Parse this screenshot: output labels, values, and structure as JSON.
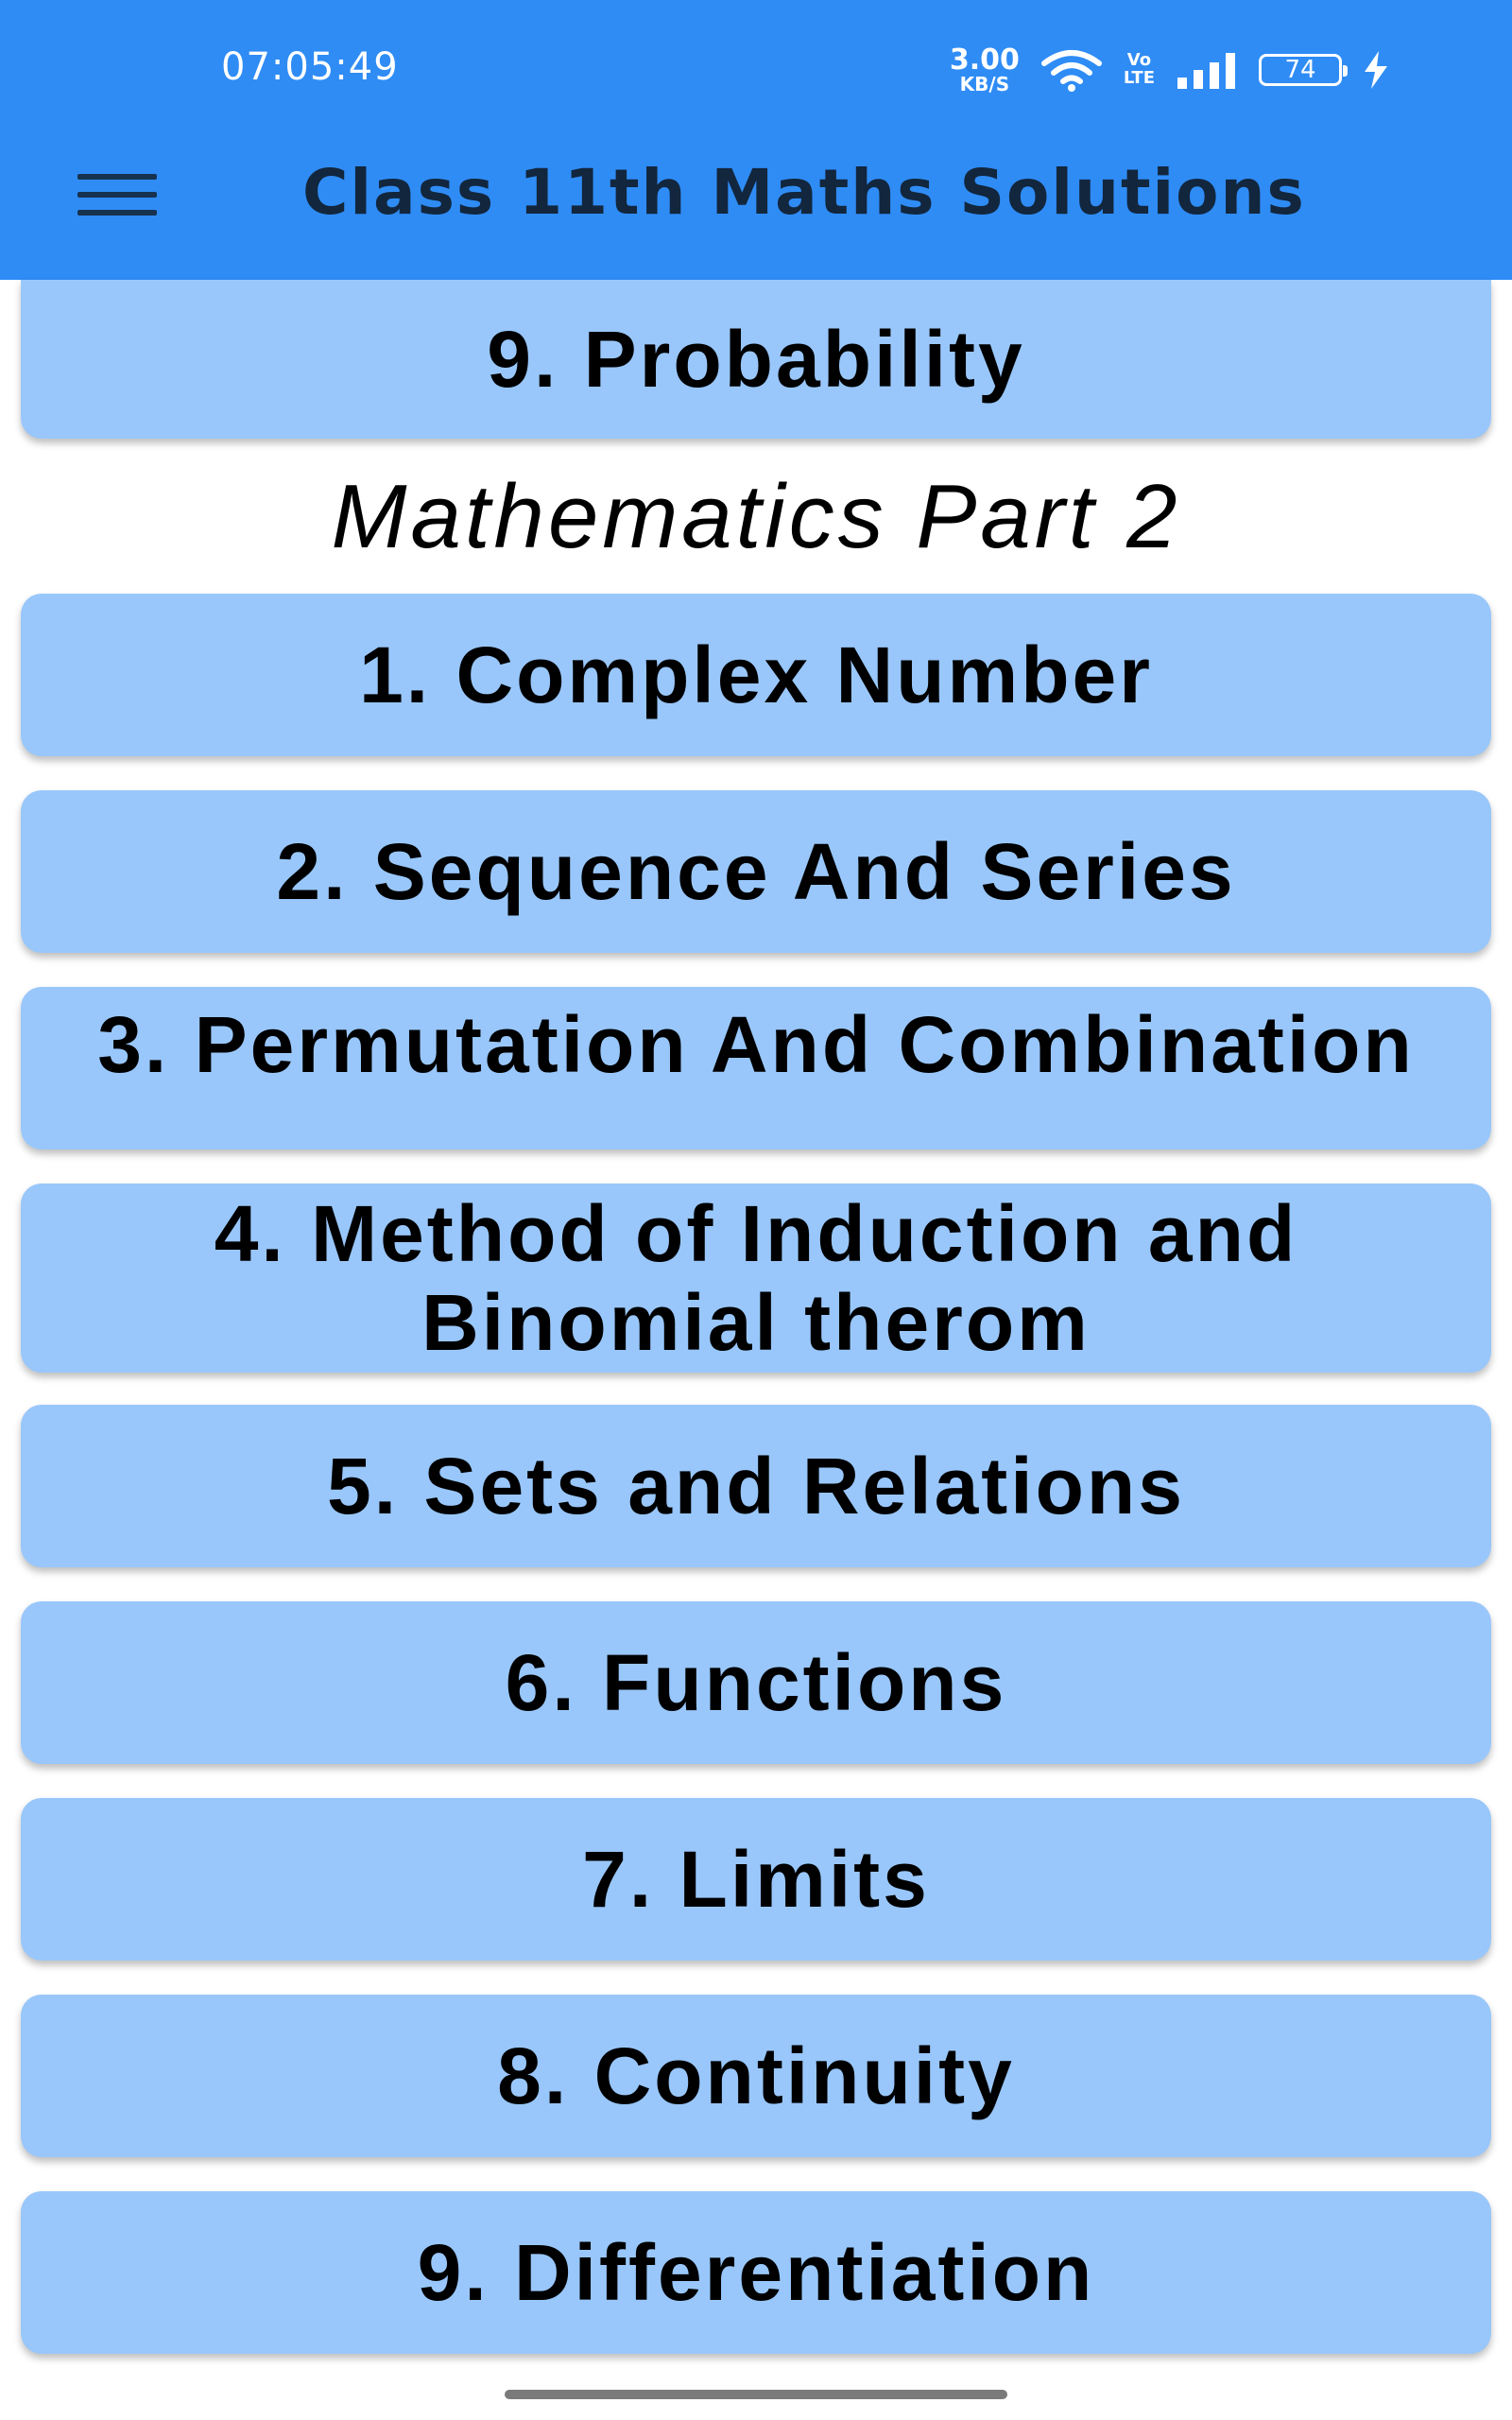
{
  "status_bar": {
    "time": "07:05:49",
    "net_speed_value": "3.00",
    "net_speed_unit": "KB/S",
    "volte_top": "Vo",
    "volte_bottom": "LTE",
    "battery_level": "74"
  },
  "app_bar": {
    "title": "Class 11th Maths Solutions",
    "menu_icon": "hamburger-menu-icon"
  },
  "top_item": {
    "label": "9. Probability"
  },
  "section": {
    "heading": "Mathematics Part 2"
  },
  "chapters": [
    {
      "label": "1. Complex Number"
    },
    {
      "label": "2. Sequence And Series"
    },
    {
      "label": "3. Permutation And Combination"
    },
    {
      "label": "4. Method of Induction and Binomial therom"
    },
    {
      "label": "5. Sets and Relations"
    },
    {
      "label": "6. Functions"
    },
    {
      "label": "7. Limits"
    },
    {
      "label": "8. Continuity"
    },
    {
      "label": "9. Differentiation"
    }
  ],
  "colors": {
    "app_bar": "#2f8cf5",
    "card": "#99c7fb",
    "title_text": "#12263d"
  }
}
